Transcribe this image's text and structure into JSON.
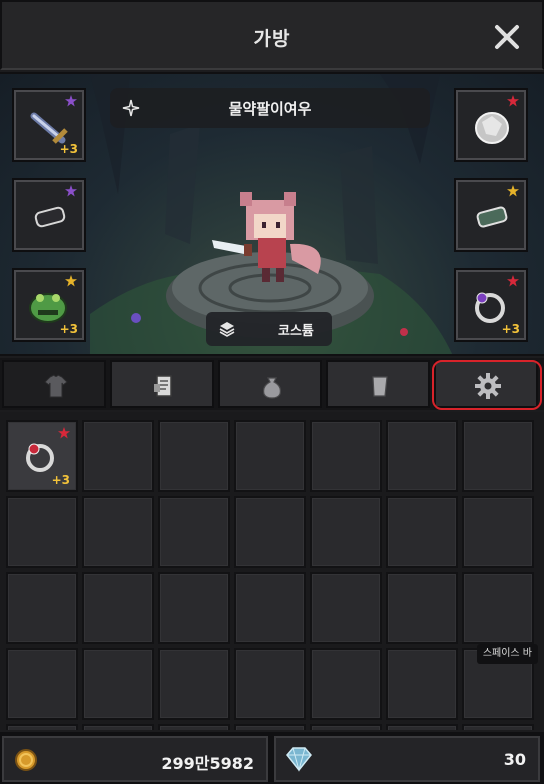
{
  "window": {
    "title": "가방"
  },
  "character": {
    "name": "물약팔이여우"
  },
  "buttons": {
    "costume": "코스튬"
  },
  "equipment": {
    "left": [
      {
        "item": "sword",
        "star": "purple",
        "plus": "+3"
      },
      {
        "item": "stone",
        "star": "purple",
        "plus": ""
      },
      {
        "item": "frog-helmet",
        "star": "gold",
        "plus": "+3"
      }
    ],
    "right": [
      {
        "item": "crystal",
        "star": "red",
        "plus": ""
      },
      {
        "item": "green-stone",
        "star": "gold",
        "plus": ""
      },
      {
        "item": "purple-ring",
        "star": "red",
        "plus": "+3"
      }
    ]
  },
  "tabs": [
    {
      "icon": "shirt-icon",
      "active": true
    },
    {
      "icon": "scroll-icon",
      "active": false
    },
    {
      "icon": "pouch-icon",
      "active": false
    },
    {
      "icon": "paper-icon",
      "active": false
    },
    {
      "icon": "gear-icon",
      "active": false
    }
  ],
  "inventory": {
    "rows": 5,
    "cols": 7,
    "items": [
      {
        "index": 0,
        "item": "red-ring",
        "star": "red",
        "plus": "+3"
      }
    ]
  },
  "tooltip": {
    "text": "스페이스 바"
  },
  "currency": {
    "gold": "299만5982",
    "gems": "30"
  },
  "colors": {
    "star_red": "#d8283a",
    "star_gold": "#e6b32a",
    "star_purple": "#8a4fc9",
    "plus": "#f2c23a",
    "highlight": "#d8232a"
  }
}
